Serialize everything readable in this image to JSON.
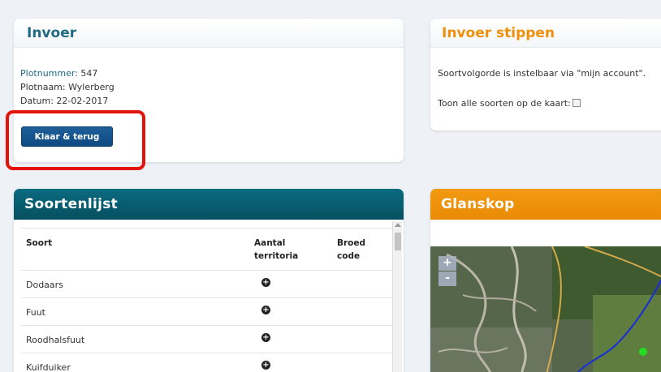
{
  "invoer": {
    "title": "Invoer",
    "plotnummer_label": "Plotnummer:",
    "plotnummer_value": "547",
    "plotnaam_label": "Plotnaam:",
    "plotnaam_value": "Wylerberg",
    "datum_label": "Datum:",
    "datum_value": "22-02-2017",
    "button_label": "Klaar & terug"
  },
  "stippen": {
    "title": "Invoer stippen",
    "info_text": "Soortvolgorde is instelbaar via \"mijn account\".",
    "toggle_label": "Toon alle soorten op de kaart:",
    "toggle_checked": false
  },
  "soortenlijst": {
    "title": "Soortenlijst",
    "columns": {
      "soort": "Soort",
      "aantal_line1": "Aantal",
      "aantal_line2": "territoria",
      "broed_line1": "Broed",
      "broed_line2": "code"
    },
    "rows": [
      {
        "soort": "Dodaars"
      },
      {
        "soort": "Fuut"
      },
      {
        "soort": "Roodhalsfuut"
      },
      {
        "soort": "Kuifduiker"
      }
    ],
    "add_icon": "plus-circle-icon"
  },
  "glanskop": {
    "title": "Glanskop",
    "zoom_in": "+",
    "zoom_out": "-"
  },
  "colors": {
    "teal_header": "#0a6b80",
    "orange_header": "#f29a12",
    "button_blue": "#1d5f9a",
    "highlight_red": "#e3120b"
  }
}
